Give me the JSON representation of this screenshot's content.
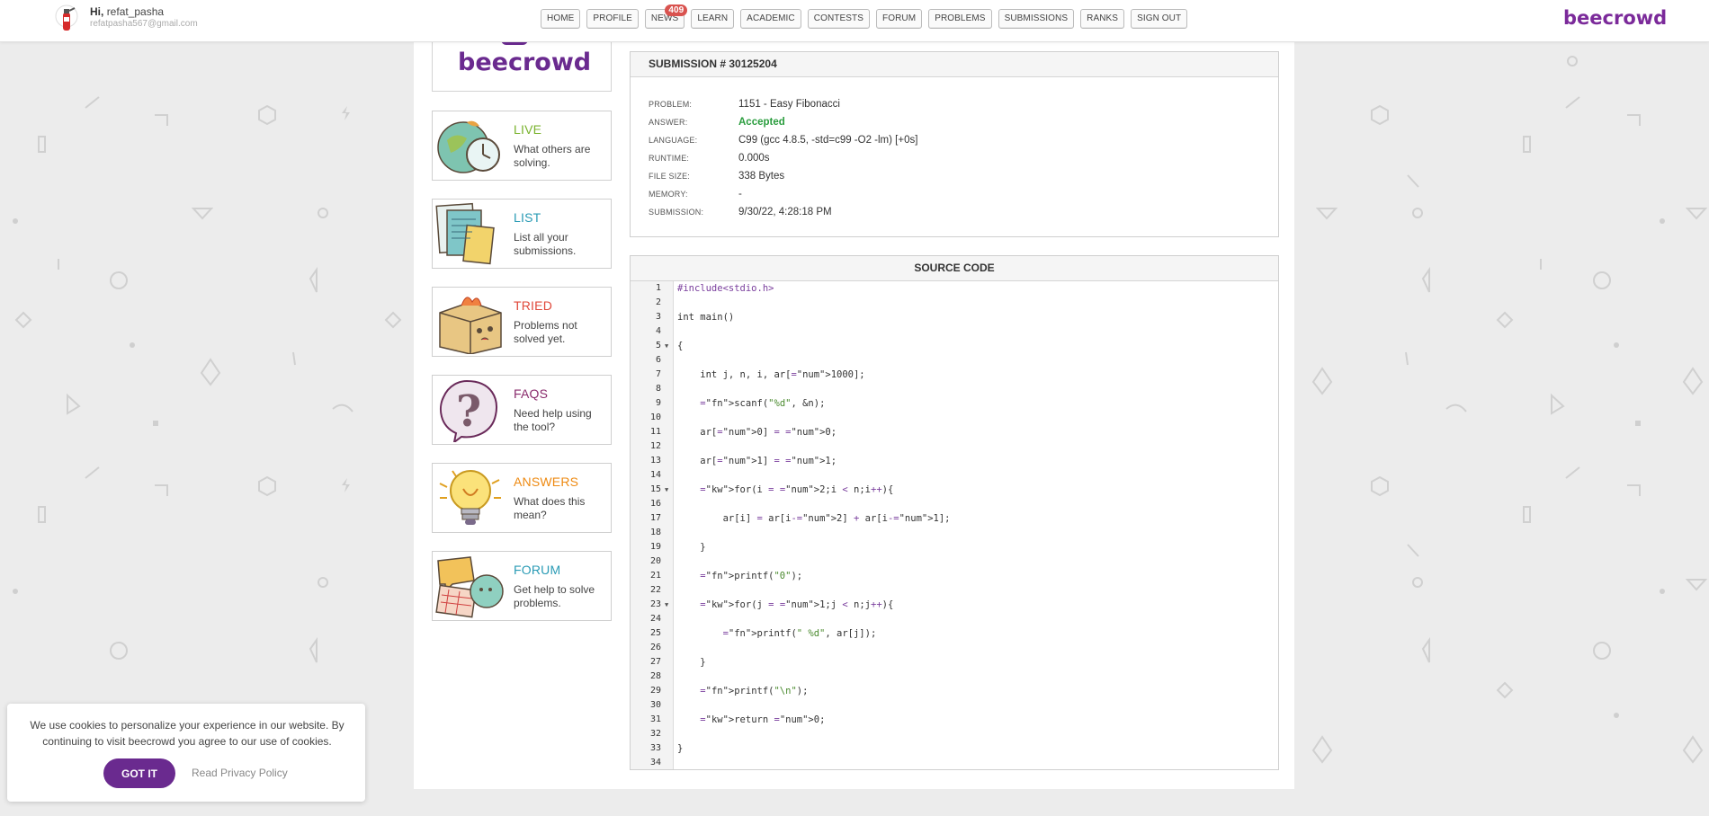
{
  "user": {
    "greeting_prefix": "Hi,",
    "username": "refat_pasha",
    "email": "refatpasha567@gmail.com"
  },
  "nav": [
    {
      "label": "HOME"
    },
    {
      "label": "PROFILE"
    },
    {
      "label": "NEWS",
      "badge": "409"
    },
    {
      "label": "LEARN"
    },
    {
      "label": "ACADEMIC"
    },
    {
      "label": "CONTESTS"
    },
    {
      "label": "FORUM"
    },
    {
      "label": "PROBLEMS"
    },
    {
      "label": "SUBMISSIONS"
    },
    {
      "label": "RANKS"
    },
    {
      "label": "SIGN OUT"
    }
  ],
  "brand": "beecrowd",
  "sidebar": [
    {
      "title": "LIVE",
      "desc": "What others are solving.",
      "color": "#7ab32e",
      "icon": "globe-clock-icon"
    },
    {
      "title": "LIST",
      "desc": "List all your submissions.",
      "color": "#2a9bb5",
      "icon": "documents-icon"
    },
    {
      "title": "TRIED",
      "desc": "Problems not solved yet.",
      "color": "#e0483a",
      "icon": "burning-box-icon"
    },
    {
      "title": "FAQS",
      "desc": "Need help using the tool?",
      "color": "#8a2c6d",
      "icon": "question-bubble-icon"
    },
    {
      "title": "ANSWERS",
      "desc": "What does this mean?",
      "color": "#ee8a12",
      "icon": "lightbulb-icon"
    },
    {
      "title": "FORUM",
      "desc": "Get help to solve problems.",
      "color": "#2a9bb5",
      "icon": "chat-bubbles-icon"
    }
  ],
  "submission": {
    "header": "SUBMISSION # 30125204",
    "rows": [
      {
        "label": "PROBLEM:",
        "value": "1151 - Easy Fibonacci"
      },
      {
        "label": "ANSWER:",
        "value": "Accepted"
      },
      {
        "label": "LANGUAGE:",
        "value": "C99 (gcc 4.8.5, -std=c99 -O2 -lm) [+0s]"
      },
      {
        "label": "RUNTIME:",
        "value": "0.000s"
      },
      {
        "label": "FILE SIZE:",
        "value": "338 Bytes"
      },
      {
        "label": "MEMORY:",
        "value": "-"
      },
      {
        "label": "SUBMISSION:",
        "value": "9/30/22, 4:28:18 PM"
      }
    ],
    "answer_color": "#2a9d3e"
  },
  "source": {
    "header": "SOURCE CODE",
    "lines": [
      "#include<stdio.h>",
      "",
      "int main()",
      "",
      "{",
      "",
      "    int j, n, i, ar[1000];",
      "",
      "    scanf(\"%d\", &n);",
      "",
      "    ar[0] = 0;",
      "",
      "    ar[1] = 1;",
      "",
      "    for(i = 2;i < n;i++){",
      "",
      "        ar[i] = ar[i-2] + ar[i-1];",
      "",
      "    }",
      "",
      "    printf(\"0\");",
      "",
      "    for(j = 1;j < n;j++){",
      "",
      "        printf(\" %d\", ar[j]);",
      "",
      "    }",
      "",
      "    printf(\"\\n\");",
      "",
      "    return 0;",
      "",
      "}",
      ""
    ],
    "fold_lines": [
      5,
      15,
      23
    ]
  },
  "cookie": {
    "text": "We use cookies to personalize your experience in our website. By continuing to visit beecrowd you agree to our use of cookies.",
    "accept_label": "GOT IT",
    "privacy_label": "Read Privacy Policy"
  },
  "colors": {
    "brand": "#6a2a8f",
    "accepted": "#2a9d3e",
    "badge": "#d9534f"
  }
}
